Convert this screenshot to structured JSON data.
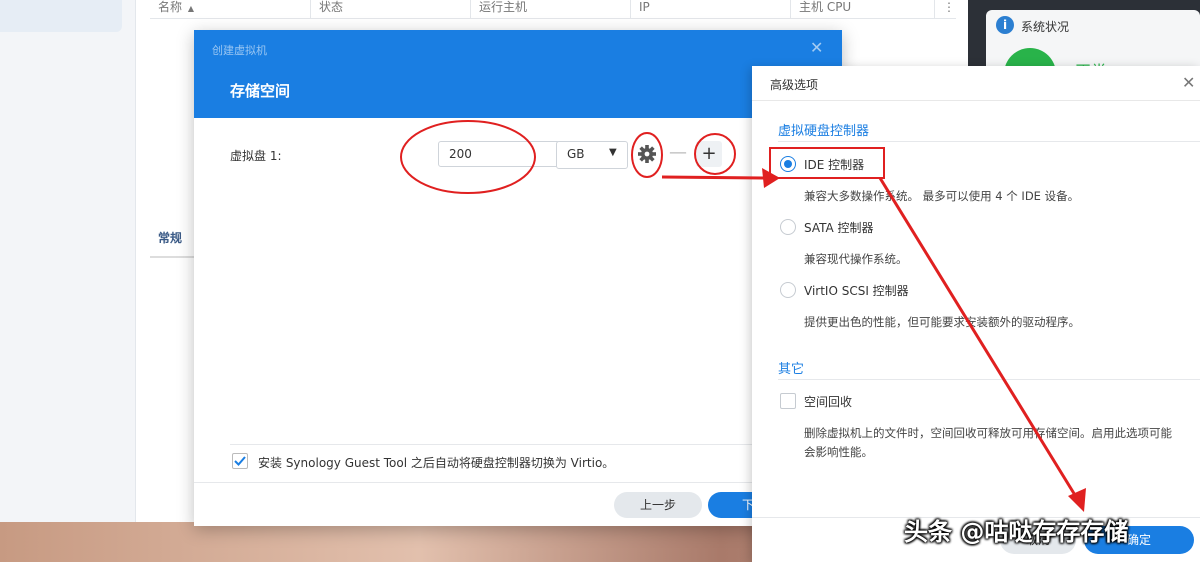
{
  "background_table": {
    "columns": [
      "名称",
      "状态",
      "运行主机",
      "IP",
      "主机 CPU"
    ],
    "sort_icon": "caret-up-icon",
    "more_icon": "vertical-dots-icon",
    "tab_label": "常规"
  },
  "status_widget": {
    "title": "系统状况",
    "status": "正常",
    "status_color": "#29b34a"
  },
  "dialog": {
    "small_title": "创建虚拟机",
    "title": "存储空间",
    "disk_label": "虚拟盘 1:",
    "size_value": "200",
    "unit_value": "GB",
    "auto_switch_checked": true,
    "auto_switch_label": "安装 Synology Guest Tool 之后自动将硬盘控制器切换为 Virtio。",
    "prev_button": "上一步",
    "next_button": "下",
    "accent": "#1a7ee2"
  },
  "advanced": {
    "title": "高级选项",
    "section_controller": "虚拟硬盘控制器",
    "options": [
      {
        "label": "IDE 控制器",
        "desc": "兼容大多数操作系统。 最多可以使用 4 个 IDE 设备。",
        "selected": true
      },
      {
        "label": "SATA 控制器",
        "desc": "兼容现代操作系统。",
        "selected": false
      },
      {
        "label": "VirtIO SCSI 控制器",
        "desc": "提供更出色的性能，但可能要求安装额外的驱动程序。",
        "selected": false
      }
    ],
    "section_other": "其它",
    "space_reclaim_label": "空间回收",
    "space_reclaim_checked": false,
    "space_reclaim_desc_1": "删除虚拟机上的文件时，空间回收可释放可用存储空间。启用此选项可能",
    "space_reclaim_desc_2": "会影响性能。",
    "ok_button": "确定",
    "cancel_button": "取消"
  },
  "watermark": "头条 @咕哒存存存储",
  "annotation_color": "#e02020"
}
